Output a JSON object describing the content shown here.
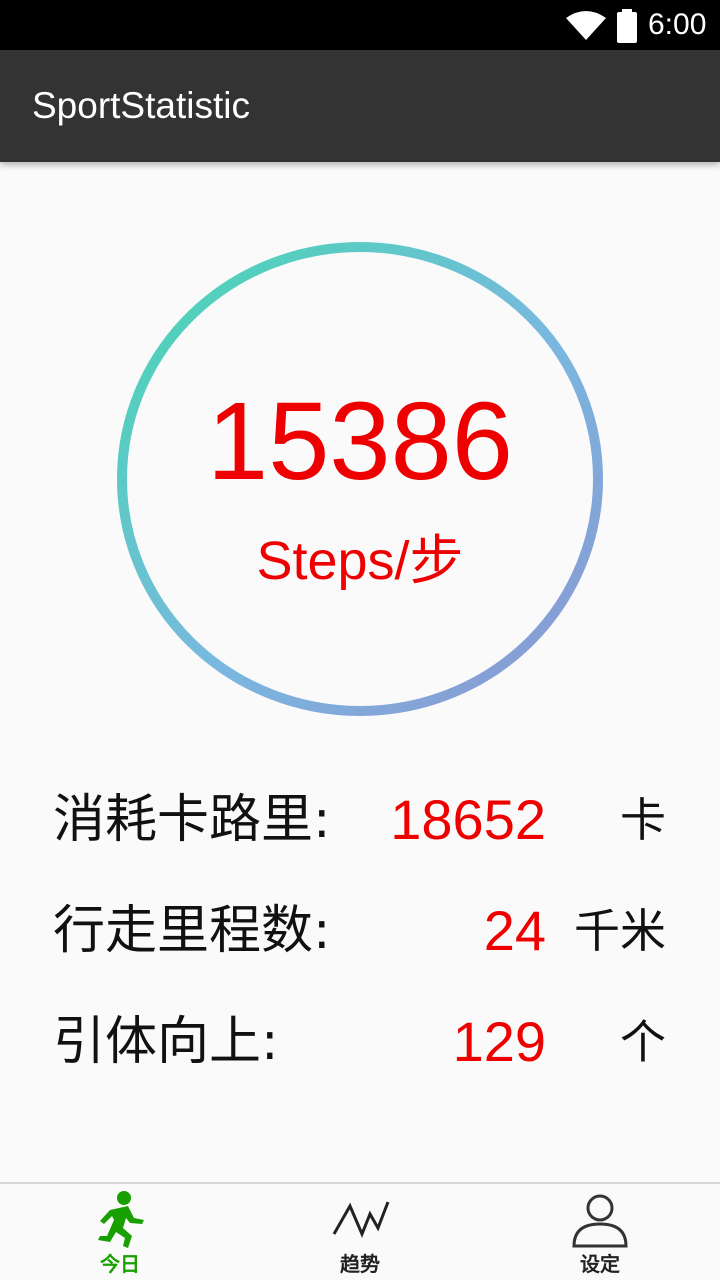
{
  "status_bar": {
    "time": "6:00",
    "wifi_icon": "wifi-icon",
    "battery_icon": "battery-icon"
  },
  "app_bar": {
    "title": "SportStatistic"
  },
  "steps": {
    "count": "15386",
    "unit": "Steps/步",
    "ring_colors": [
      "#44d8b0",
      "#7ab8e0",
      "#8b94d0"
    ]
  },
  "stats": [
    {
      "label": "消耗卡路里:",
      "value": "18652",
      "unit": "卡"
    },
    {
      "label": "行走里程数:",
      "value": "24",
      "unit": "千米"
    },
    {
      "label": "引体向上:",
      "value": "129",
      "unit": "个"
    }
  ],
  "bottom_nav": [
    {
      "label": "今日",
      "icon": "running-man-icon",
      "active": true
    },
    {
      "label": "趋势",
      "icon": "trend-line-icon",
      "active": false
    },
    {
      "label": "设定",
      "icon": "user-profile-icon",
      "active": false
    }
  ],
  "colors": {
    "accent": "#ee0000",
    "active_tab": "#18a000",
    "app_bar": "#333333"
  }
}
